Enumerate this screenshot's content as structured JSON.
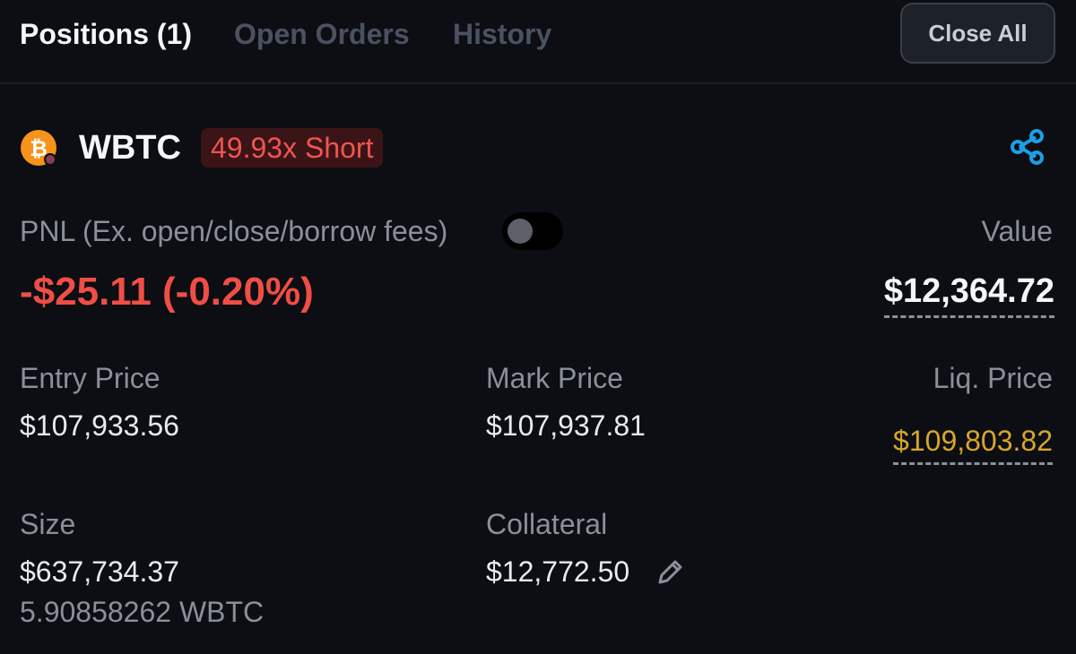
{
  "tabs": {
    "positions": "Positions (1)",
    "open_orders": "Open Orders",
    "history": "History",
    "close_all": "Close All"
  },
  "position": {
    "icon": "bitcoin-icon",
    "ticker": "WBTC",
    "side_badge": "49.93x Short",
    "share_icon": "share-icon",
    "pnl_label": "PNL (Ex. open/close/borrow fees)",
    "pnl_toggle_on": false,
    "pnl_value": "-$25.11 (-0.20%)",
    "value_label": "Value",
    "value": "$12,364.72",
    "entry_price_label": "Entry Price",
    "entry_price": "$107,933.56",
    "mark_price_label": "Mark Price",
    "mark_price": "$107,937.81",
    "liq_price_label": "Liq. Price",
    "liq_price": "$109,803.82",
    "size_label": "Size",
    "size_usd": "$637,734.37",
    "size_token": "5.90858262 WBTC",
    "collateral_label": "Collateral",
    "collateral": "$12,772.50",
    "edit_icon": "pencil-icon"
  },
  "colors": {
    "background": "#0c0e13",
    "loss": "#f04e45",
    "short_badge_bg": "#3a1416",
    "liquidation": "#d9a62a",
    "accent": "#1aa0e6",
    "bitcoin": "#f7931a"
  }
}
